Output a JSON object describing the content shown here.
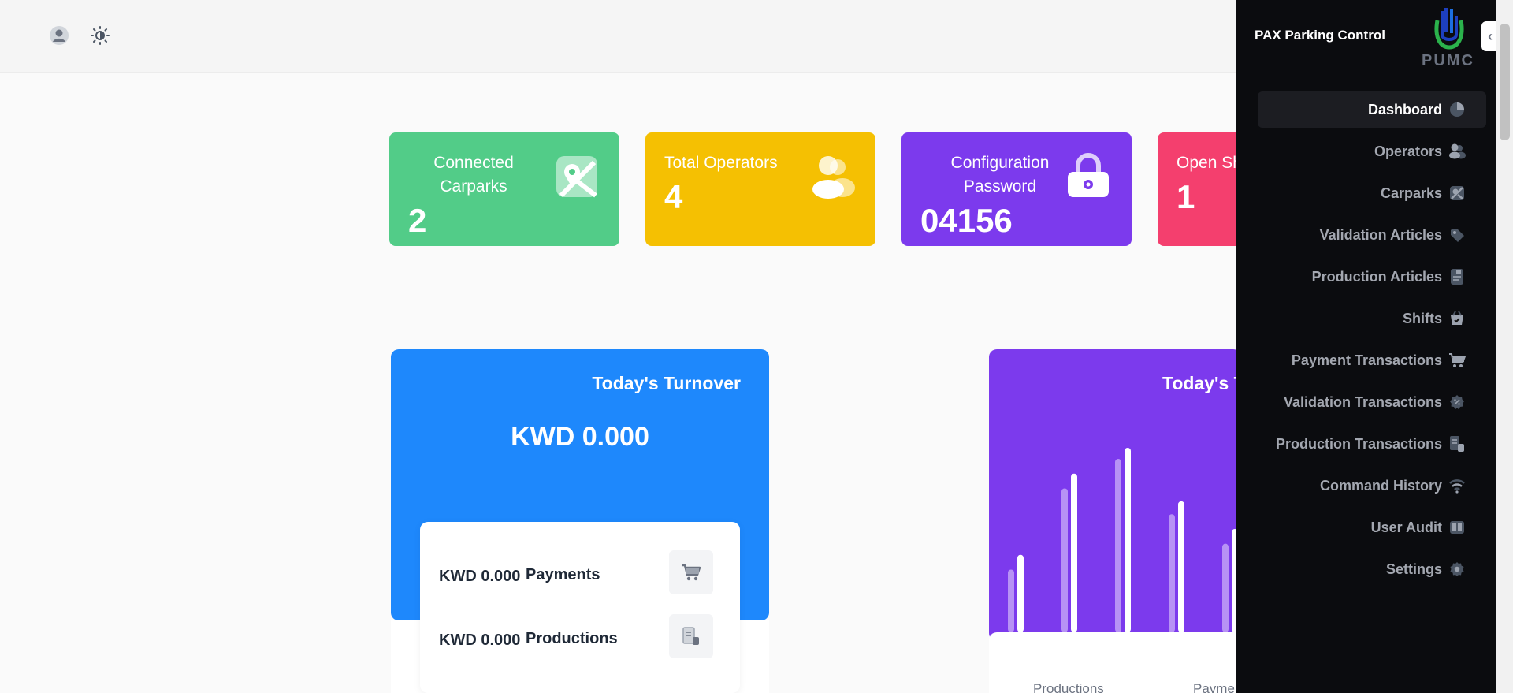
{
  "brand": {
    "title": "PAX Parking Control",
    "logo_text": "PUMC"
  },
  "topbar": {
    "user_icon": "user-icon",
    "theme_icon": "sun-icon"
  },
  "stats": [
    {
      "label": "Connected Carparks",
      "value": "2",
      "color": "#52cc88",
      "icon": "map-icon"
    },
    {
      "label": "Total Operators",
      "value": "4",
      "color": "#f5c002",
      "icon": "users-icon"
    },
    {
      "label": "Configuration Password",
      "value": "04156",
      "color": "#7c3aed",
      "icon": "lock-icon"
    },
    {
      "label": "Open Sh",
      "value": "1",
      "color": "#f43f6e",
      "icon": ""
    }
  ],
  "turnover": {
    "title": "Today's Turnover",
    "amount": "KWD 0.000",
    "rows": [
      {
        "amount": "KWD 0.000",
        "label": "Payments",
        "icon": "cart-icon"
      },
      {
        "amount": "KWD 0.000",
        "label": "Productions",
        "icon": "document-icon"
      }
    ]
  },
  "today2": {
    "title": "Today's T",
    "axis": [
      "Productions",
      "Payme"
    ],
    "bars": [
      {
        "back": 0.34,
        "front": 0.42
      },
      {
        "back": 0.78,
        "front": 0.86
      },
      {
        "back": 0.94,
        "front": 1.0
      },
      {
        "back": 0.64,
        "front": 0.71
      },
      {
        "back": 0.48,
        "front": 0.56
      }
    ]
  },
  "sidebar": {
    "items": [
      {
        "label": "Dashboard",
        "icon": "pie-chart-icon",
        "active": true
      },
      {
        "label": "Operators",
        "icon": "users-icon",
        "active": false
      },
      {
        "label": "Carparks",
        "icon": "map-icon",
        "active": false
      },
      {
        "label": "Validation Articles",
        "icon": "tag-icon",
        "active": false
      },
      {
        "label": "Production Articles",
        "icon": "document-icon",
        "active": false
      },
      {
        "label": "Shifts",
        "icon": "basket-icon",
        "active": false
      },
      {
        "label": "Payment Transactions",
        "icon": "cart-icon",
        "active": false
      },
      {
        "label": "Validation Transactions",
        "icon": "badge-percent-icon",
        "active": false
      },
      {
        "label": "Production Transactions",
        "icon": "receipt-icon",
        "active": false
      },
      {
        "label": "Command History",
        "icon": "wifi-icon",
        "active": false
      },
      {
        "label": "User Audit",
        "icon": "book-icon",
        "active": false
      },
      {
        "label": "Settings",
        "icon": "gear-icon",
        "active": false
      }
    ]
  }
}
